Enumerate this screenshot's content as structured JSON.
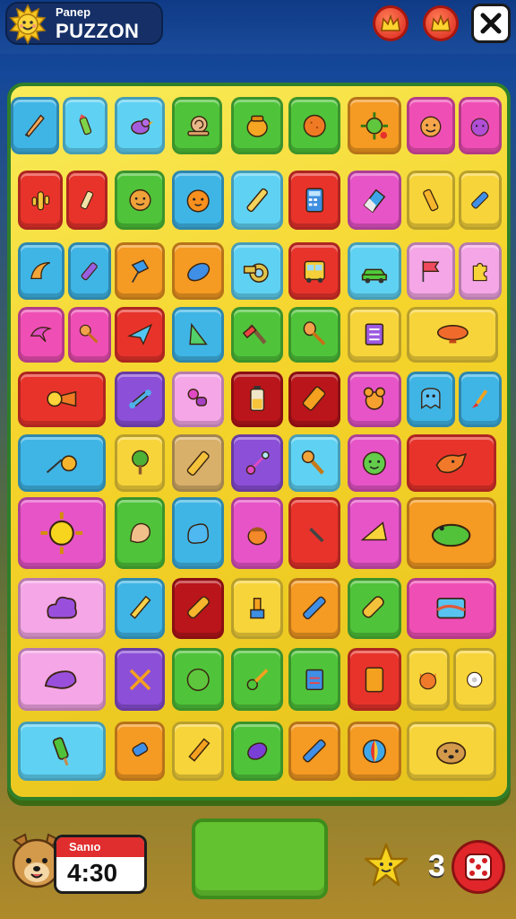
{
  "header": {
    "subtitle": "Panep",
    "title": "PUZZON",
    "logo_icon": "sun-face-icon",
    "buttons": [
      {
        "name": "crown-button-1",
        "icon": "crown-icon"
      },
      {
        "name": "crown-button-2",
        "icon": "crown-icon"
      },
      {
        "name": "close-button",
        "icon": "close-icon"
      }
    ]
  },
  "colors": {
    "red": "#e8332b",
    "green": "#4fc43a",
    "blue": "#3fb5e6",
    "cyan": "#5fd2f3",
    "yellow": "#f7d43a",
    "orange": "#f59a22",
    "pink": "#ef4fb5",
    "purple": "#8b4fd8",
    "magenta": "#e754c8",
    "light_pink": "#f4a6e6",
    "dark_red": "#b9151a",
    "tan": "#d8b06a"
  },
  "board": {
    "rows": [
      [
        {
          "color": "blue",
          "icon": "pencil-icon"
        },
        {
          "color": "cyan",
          "icon": "crayon-icon"
        },
        {
          "color": "cyan",
          "icon": "bird-icon"
        },
        {
          "color": "green",
          "icon": "snail-icon"
        },
        {
          "color": "green",
          "icon": "honey-pot-icon"
        },
        {
          "color": "green",
          "icon": "orange-ball-icon"
        },
        {
          "color": "orange",
          "icon": "virus-icon"
        },
        {
          "color": "pink",
          "icon": "smiley-face-icon"
        },
        {
          "color": "pink",
          "icon": "cat-face-icon"
        }
      ],
      [
        {
          "color": "red",
          "icon": "cactus-icon"
        },
        {
          "color": "red",
          "icon": "marker-icon"
        },
        {
          "color": "green",
          "icon": "cookie-face-icon"
        },
        {
          "color": "blue",
          "icon": "orange-face-icon"
        },
        {
          "color": "cyan",
          "icon": "pen-icon"
        },
        {
          "color": "red",
          "icon": "calculator-icon"
        },
        {
          "color": "magenta",
          "icon": "eraser-icon"
        },
        {
          "color": "yellow",
          "icon": "yellow-crayon-icon"
        },
        {
          "color": "yellow",
          "icon": "blue-marker-icon"
        }
      ],
      [
        {
          "color": "blue",
          "icon": "croissant-icon"
        },
        {
          "color": "blue",
          "icon": "purple-crayon-icon"
        },
        {
          "color": "orange",
          "icon": "pushpin-icon"
        },
        {
          "color": "orange",
          "icon": "soap-icon"
        },
        {
          "color": "cyan",
          "icon": "tape-icon"
        },
        {
          "color": "red",
          "icon": "bus-icon"
        },
        {
          "color": "cyan",
          "icon": "car-icon"
        },
        {
          "color": "light_pink",
          "icon": "flag-icon"
        },
        {
          "color": "light_pink",
          "icon": "puzzle-piece-icon"
        }
      ],
      [
        {
          "color": "pink",
          "icon": "dolphin-icon"
        },
        {
          "color": "pink",
          "icon": "rattle-icon"
        },
        {
          "color": "red",
          "icon": "paper-plane-icon"
        },
        {
          "color": "blue",
          "icon": "triangle-ruler-icon"
        },
        {
          "color": "green",
          "icon": "hammer-icon"
        },
        {
          "color": "green",
          "icon": "spoon-icon"
        },
        {
          "color": "yellow",
          "icon": "notebook-icon"
        },
        {
          "color": "yellow",
          "icon": "blimp-icon"
        }
      ],
      [
        {
          "color": "red",
          "icon": "comet-icon"
        },
        {
          "color": "purple",
          "icon": "bone-icon"
        },
        {
          "color": "light_pink",
          "icon": "pacifier-icon"
        },
        {
          "color": "dark_red",
          "icon": "battery-icon"
        },
        {
          "color": "dark_red",
          "icon": "usb-drive-icon"
        },
        {
          "color": "magenta",
          "icon": "teddy-bear-icon"
        },
        {
          "color": "blue",
          "icon": "ghost-icon"
        },
        {
          "color": "blue",
          "icon": "paintbrush-icon"
        }
      ],
      [
        {
          "color": "blue",
          "icon": "shooting-star-icon"
        },
        {
          "color": "yellow",
          "icon": "tree-icon"
        },
        {
          "color": "tan",
          "icon": "chalk-icon"
        },
        {
          "color": "purple",
          "icon": "bubble-wand-icon"
        },
        {
          "color": "cyan",
          "icon": "wrench-icon"
        },
        {
          "color": "magenta",
          "icon": "green-face-icon"
        },
        {
          "color": "red",
          "icon": "fox-icon"
        }
      ],
      [
        {
          "color": "magenta",
          "icon": "sun-icon"
        },
        {
          "color": "green",
          "icon": "shell-icon"
        },
        {
          "color": "blue",
          "icon": "blob-icon"
        },
        {
          "color": "magenta",
          "icon": "acorn-icon"
        },
        {
          "color": "red",
          "icon": "pliers-icon"
        },
        {
          "color": "magenta",
          "icon": "cheese-icon"
        },
        {
          "color": "orange",
          "icon": "crocodile-icon"
        }
      ],
      [
        {
          "color": "light_pink",
          "icon": "purple-cloud-icon"
        },
        {
          "color": "blue",
          "icon": "blue-pencil-icon"
        },
        {
          "color": "dark_red",
          "icon": "yellow-marker-icon"
        },
        {
          "color": "yellow",
          "icon": "stamp-icon"
        },
        {
          "color": "orange",
          "icon": "blue-pen-icon"
        },
        {
          "color": "green",
          "icon": "whistle-icon"
        },
        {
          "color": "pink",
          "icon": "painting-icon"
        }
      ],
      [
        {
          "color": "light_pink",
          "icon": "sea-creature-icon"
        },
        {
          "color": "purple",
          "icon": "cross-sticks-icon"
        },
        {
          "color": "green",
          "icon": "lime-icon"
        },
        {
          "color": "green",
          "icon": "key-icon"
        },
        {
          "color": "green",
          "icon": "book-icon"
        },
        {
          "color": "red",
          "icon": "tablet-icon"
        },
        {
          "color": "yellow",
          "icon": "kitten-icon"
        },
        {
          "color": "yellow",
          "icon": "gear-icon"
        }
      ],
      [
        {
          "color": "cyan",
          "icon": "popsicle-icon"
        },
        {
          "color": "orange",
          "icon": "blue-tube-icon"
        },
        {
          "color": "yellow",
          "icon": "paint-pen-icon"
        },
        {
          "color": "green",
          "icon": "purple-egg-icon"
        },
        {
          "color": "orange",
          "icon": "glue-stick-icon"
        },
        {
          "color": "orange",
          "icon": "beach-ball-icon"
        },
        {
          "color": "yellow",
          "icon": "dog-icon"
        }
      ]
    ]
  },
  "footer": {
    "timer_label": "Sanıo",
    "timer_value": "4:30",
    "avatar_icon": "dog-face-icon",
    "hint_icon": "star-icon",
    "count": "3",
    "dice_icon": "dice-icon"
  }
}
